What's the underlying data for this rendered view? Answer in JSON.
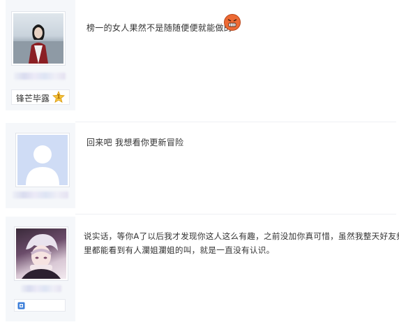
{
  "posts": [
    {
      "author_badge": "锋芒毕露",
      "badge_level": "1",
      "text": "榜一的女人果然不是随随便便就能做的",
      "emoji": "angry-face-emoji"
    },
    {
      "text": "回来吧 我想看你更新冒险"
    },
    {
      "text_line1": "说实话，等你A了以后我才发现你这人这么有趣，之前没加你真可惜，虽然我整天好友频道",
      "text_line2": "里都能看到有人瀾姐瀾姐的叫，就是一直没有认识。"
    }
  ]
}
